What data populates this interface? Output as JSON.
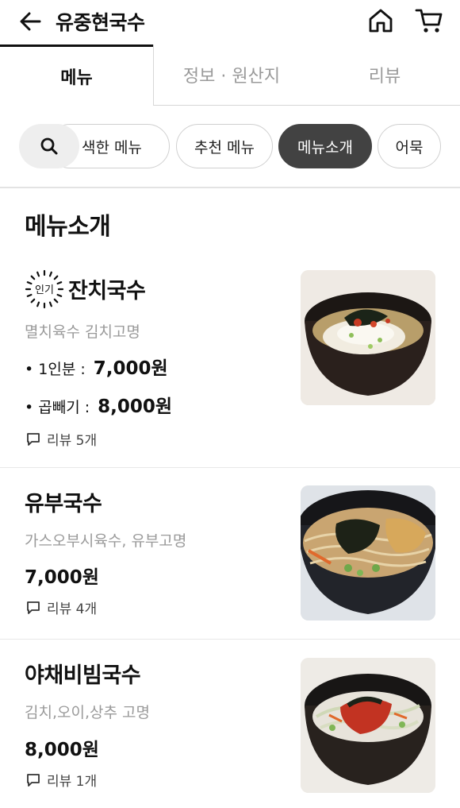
{
  "header": {
    "title": "유중현국수",
    "back_icon": "arrow-left-icon",
    "home_icon": "home-icon",
    "cart_icon": "cart-icon"
  },
  "tabs": [
    {
      "label": "메뉴",
      "active": true
    },
    {
      "label": "정보 · 원산지",
      "active": false
    },
    {
      "label": "리뷰",
      "active": false
    }
  ],
  "chips": {
    "search_icon": "search-icon",
    "items": [
      {
        "label": "색한 메뉴",
        "active": false
      },
      {
        "label": "추천 메뉴",
        "active": false
      },
      {
        "label": "메뉴소개",
        "active": true
      },
      {
        "label": "어묵",
        "active": false
      }
    ]
  },
  "section": {
    "title": "메뉴소개"
  },
  "menu": [
    {
      "badge": "인기",
      "name": "잔치국수",
      "desc": "멸치육수 김치고명",
      "prices": [
        {
          "label": "• 1인분 :",
          "value": "7,000원"
        },
        {
          "label": "• 곱빼기 :",
          "value": "8,000원"
        }
      ],
      "review": "리뷰 5개"
    },
    {
      "name": "유부국수",
      "desc": "가스오부시육수, 유부고명",
      "price": "7,000원",
      "review": "리뷰 4개"
    },
    {
      "name": "야채비빔국수",
      "desc": "김치,오이,상추 고명",
      "price": "8,000원",
      "review": "리뷰 1개"
    }
  ],
  "colors": {
    "active_chip": "#424242",
    "inactive_text": "#9a9a9a",
    "divider": "#e3e3e3"
  }
}
